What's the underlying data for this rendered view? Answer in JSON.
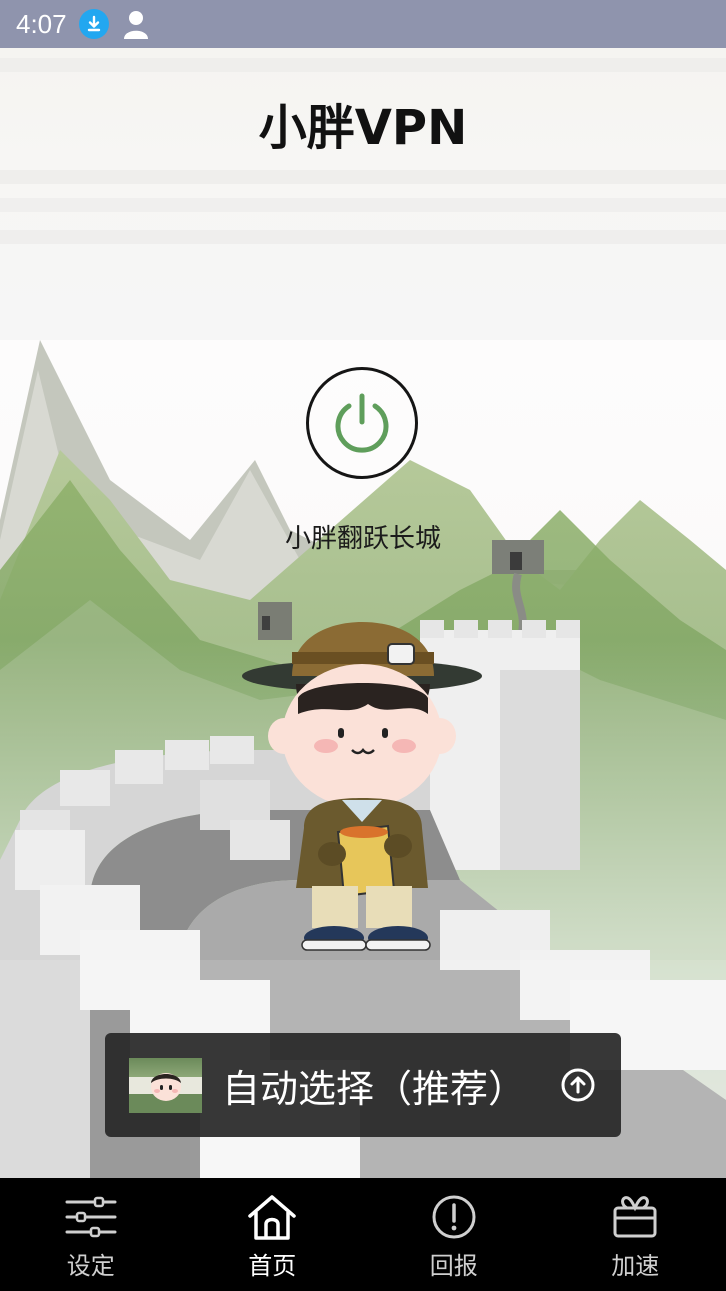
{
  "status_bar": {
    "time": "4:07",
    "icons": [
      "download-icon",
      "user-icon"
    ]
  },
  "app": {
    "title": "小胖VPN"
  },
  "main": {
    "power_button_icon": "power-icon",
    "status_text": "小胖翻跃长城",
    "power_color": "#5f9e5b"
  },
  "server": {
    "label": "自动选择（推荐）",
    "icon": "upload-circle-icon"
  },
  "nav": {
    "items": [
      {
        "label": "设定",
        "icon": "sliders-icon"
      },
      {
        "label": "首页",
        "icon": "home-icon"
      },
      {
        "label": "回报",
        "icon": "alert-circle-icon"
      },
      {
        "label": "加速",
        "icon": "gift-icon"
      }
    ]
  }
}
